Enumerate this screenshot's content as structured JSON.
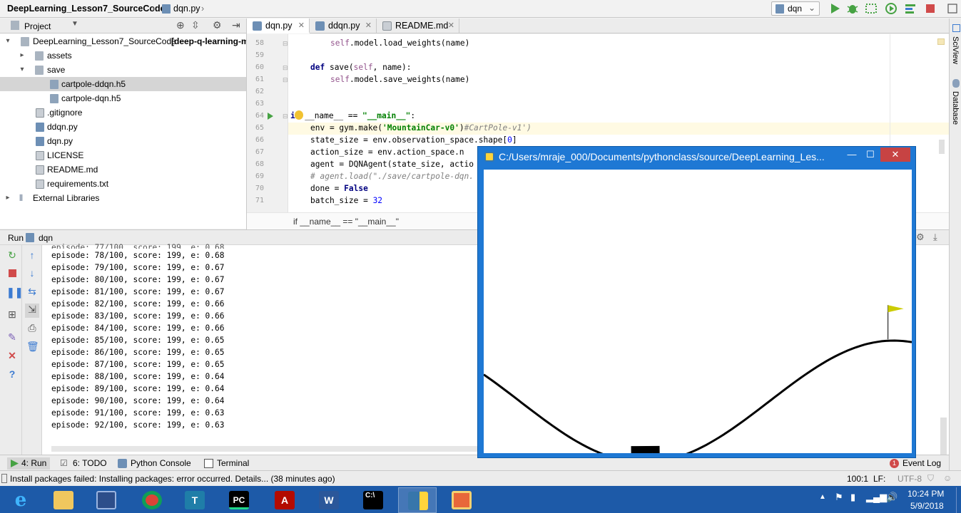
{
  "navbar": {
    "project": "DeepLearning_Lesson7_SourceCode",
    "file": "dqn.py",
    "run_config": "dqn"
  },
  "project_panel": {
    "title": "Project",
    "root_label": "DeepLearning_Lesson7_SourceCode",
    "root_suffix": "[deep-q-learning-m",
    "items": [
      {
        "label": "assets",
        "type": "folder"
      },
      {
        "label": "save",
        "type": "folder"
      },
      {
        "label": "cartpole-ddqn.h5",
        "type": "h5"
      },
      {
        "label": "cartpole-dqn.h5",
        "type": "h5"
      },
      {
        "label": ".gitignore",
        "type": "text"
      },
      {
        "label": "ddqn.py",
        "type": "py"
      },
      {
        "label": "dqn.py",
        "type": "py"
      },
      {
        "label": "LICENSE",
        "type": "text"
      },
      {
        "label": "README.md",
        "type": "text"
      },
      {
        "label": "requirements.txt",
        "type": "text"
      },
      {
        "label": "External Libraries",
        "type": "lib"
      }
    ]
  },
  "editor": {
    "tabs": [
      {
        "label": "dqn.py",
        "active": true
      },
      {
        "label": "ddqn.py",
        "active": false
      },
      {
        "label": "README.md",
        "active": false
      }
    ],
    "line_numbers": [
      "58",
      "59",
      "60",
      "61",
      "62",
      "63",
      "64",
      "65",
      "66",
      "67",
      "68",
      "69",
      "70",
      "71"
    ],
    "breadcrumb": "if __name__ == \"__main__\"",
    "lines": [
      {
        "self_": "self",
        "rest": ".model.load_weights(name)"
      },
      {
        "def": "def",
        "rest": " save(",
        "self_": "self",
        "rest2": ", name):"
      },
      {
        "self_": "self",
        "rest": ".model.save_weights(name)"
      },
      {
        "kw": "if",
        "mid": " __name__ == ",
        "str": "\"__main__\"",
        "end": ":"
      },
      {
        "a": "env = gym.make(",
        "str": "'MountainCar-v0'",
        "b": ")",
        "cmt": "#CartPole-v1')"
      },
      {
        "a": "state_size = env.observation_space.shape[",
        "num": "0",
        "b": "]"
      },
      {
        "a": "action_size = env.action_space.n"
      },
      {
        "a": "agent = DQNAgent(state_size, actio"
      },
      {
        "cmt": "# agent.load(\"./save/cartpole-dqn."
      },
      {
        "a": "done = ",
        "kw": "False"
      },
      {
        "a": "batch_size = ",
        "num": "32"
      }
    ]
  },
  "run_panel": {
    "title": "Run",
    "config": "dqn",
    "output": [
      "episode: 78/100, score: 199, e: 0.68",
      "episode: 79/100, score: 199, e: 0.67",
      "episode: 80/100, score: 199, e: 0.67",
      "episode: 81/100, score: 199, e: 0.67",
      "episode: 82/100, score: 199, e: 0.66",
      "episode: 83/100, score: 199, e: 0.66",
      "episode: 84/100, score: 199, e: 0.66",
      "episode: 85/100, score: 199, e: 0.65",
      "episode: 86/100, score: 199, e: 0.65",
      "episode: 87/100, score: 199, e: 0.65",
      "episode: 88/100, score: 199, e: 0.64",
      "episode: 89/100, score: 199, e: 0.64",
      "episode: 90/100, score: 199, e: 0.64",
      "episode: 91/100, score: 199, e: 0.63",
      "episode: 92/100, score: 199, e: 0.63"
    ]
  },
  "bottom_tabs": {
    "run": "4: Run",
    "todo": "6: TODO",
    "python_console": "Python Console",
    "terminal": "Terminal",
    "event_log": "Event Log"
  },
  "status": {
    "message": "Install packages failed: Installing packages: error occurred. Details... (38 minutes ago)",
    "position": "100:1",
    "line_sep": "LF:",
    "encoding": "UTF-8"
  },
  "right_strip": {
    "sciview": "SciView",
    "database": "Database"
  },
  "game_window": {
    "title": "C:/Users/mraje_000/Documents/pythonclass/source/DeepLearning_Les...",
    "min": "—",
    "max": "☐",
    "close": "✕",
    "car_position": -0.52,
    "goal_position": 0.5
  },
  "taskbar": {
    "apps": [
      "Internet Explorer",
      "File Explorer",
      "VirtualBox",
      "Chrome",
      "Typora",
      "PyCharm",
      "Acrobat",
      "Word",
      "Command Prompt",
      "Python",
      "Paint"
    ],
    "time": "10:24 PM",
    "date": "5/9/2018"
  },
  "colors": {
    "accent": "#1e78d4",
    "taskbar": "#1d5aa8",
    "close": "#c74343"
  }
}
